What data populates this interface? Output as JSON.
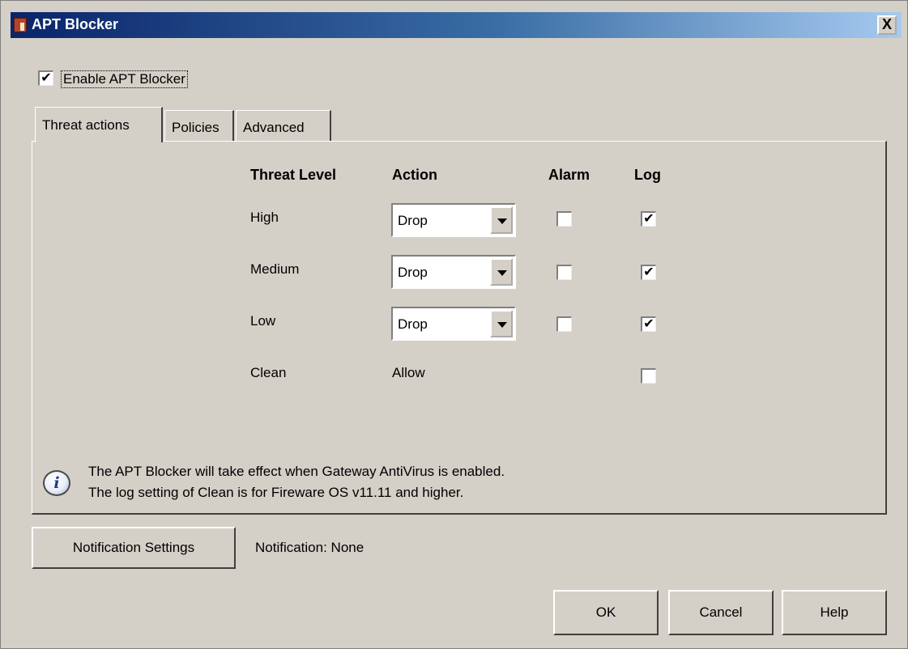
{
  "window": {
    "title": "APT Blocker",
    "close_glyph": "X"
  },
  "enable": {
    "label": "Enable APT Blocker",
    "checked": true
  },
  "tabs": [
    {
      "label": "Threat actions",
      "active": true
    },
    {
      "label": "Policies",
      "active": false
    },
    {
      "label": "Advanced",
      "active": false
    }
  ],
  "table": {
    "headers": {
      "level": "Threat Level",
      "action": "Action",
      "alarm": "Alarm",
      "log": "Log"
    },
    "rows": [
      {
        "level": "High",
        "action": "Drop",
        "alarm": false,
        "log": true
      },
      {
        "level": "Medium",
        "action": "Drop",
        "alarm": false,
        "log": true
      },
      {
        "level": "Low",
        "action": "Drop",
        "alarm": false,
        "log": true
      },
      {
        "level": "Clean",
        "action": "Allow",
        "log": false
      }
    ]
  },
  "info": {
    "icon": "info-icon",
    "line1": "The APT Blocker will take effect when Gateway AntiVirus is enabled.",
    "line2": "The log setting of Clean is for Fireware OS v11.11 and higher."
  },
  "notification": {
    "button_label": "Notification Settings",
    "status": "Notification: None"
  },
  "buttons": {
    "ok": "OK",
    "cancel": "Cancel",
    "help": "Help"
  },
  "glyphs": {
    "check": "✔"
  }
}
